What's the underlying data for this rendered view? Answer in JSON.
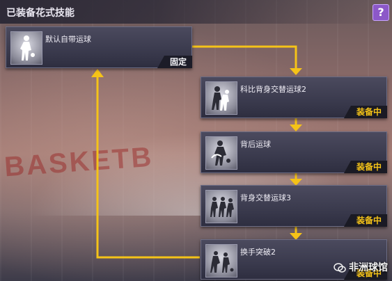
{
  "header": {
    "title": "已装备花式技能",
    "help_label": "?"
  },
  "background": {
    "court_text": "BASKETB"
  },
  "cards": [
    {
      "name": "默认自带运球",
      "tag": "固定",
      "tag_kind": "fixed",
      "icon": "default-dribble-icon"
    },
    {
      "name": "科比背身交替运球2",
      "tag": "装备中",
      "tag_kind": "equipped",
      "icon": "kobe-back-dribble-icon"
    },
    {
      "name": "背后运球",
      "tag": "装备中",
      "tag_kind": "equipped",
      "icon": "behind-back-dribble-icon"
    },
    {
      "name": "背身交替运球3",
      "tag": "装备中",
      "tag_kind": "equipped",
      "icon": "back-alternate-dribble-icon"
    },
    {
      "name": "换手突破2",
      "tag": "装备中",
      "tag_kind": "equipped",
      "icon": "crossover-drive-icon"
    }
  ],
  "watermark": {
    "text": "非洲球馆"
  },
  "colors": {
    "arrow": "#f5c318",
    "tag_equipped": "#f5c318",
    "help_button": "#8c58c8"
  }
}
